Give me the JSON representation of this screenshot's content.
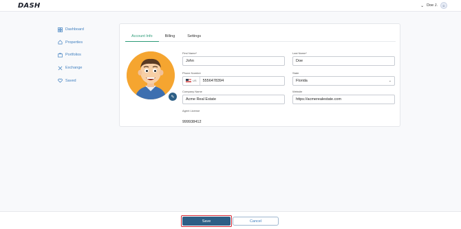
{
  "header": {
    "logo": "DASH",
    "user_name": "Doe J.",
    "user_initial": "D"
  },
  "sidebar": {
    "items": [
      {
        "label": "Dashboard",
        "icon": "grid-icon"
      },
      {
        "label": "Properties",
        "icon": "home-icon"
      },
      {
        "label": "Portfolios",
        "icon": "portfolio-icon"
      },
      {
        "label": "Exchange",
        "icon": "exchange-icon"
      },
      {
        "label": "Saved",
        "icon": "heart-icon"
      }
    ]
  },
  "tabs": [
    {
      "label": "Account Info",
      "active": true
    },
    {
      "label": "Billing",
      "active": false
    },
    {
      "label": "Settings",
      "active": false
    }
  ],
  "form": {
    "first_name": {
      "label": "First Name*",
      "value": "John"
    },
    "last_name": {
      "label": "Last Name*",
      "value": "Doe"
    },
    "phone": {
      "label": "Phone Number",
      "country": "US",
      "value": "5556478394"
    },
    "state": {
      "label": "State",
      "value": "Florida"
    },
    "company": {
      "label": "Company Name",
      "value": "Acme Real Estate"
    },
    "website": {
      "label": "Website",
      "value": "https://acmerealestate.com"
    },
    "agent_license": {
      "label": "Agent License",
      "value": "999938412"
    }
  },
  "footer": {
    "save_label": "Save",
    "cancel_label": "Cancel"
  },
  "colors": {
    "accent": "#2a9a76",
    "primary": "#2d5f86",
    "link": "#3f7fbf",
    "highlight": "#d3232f",
    "avatar_bg": "#f5a530"
  }
}
